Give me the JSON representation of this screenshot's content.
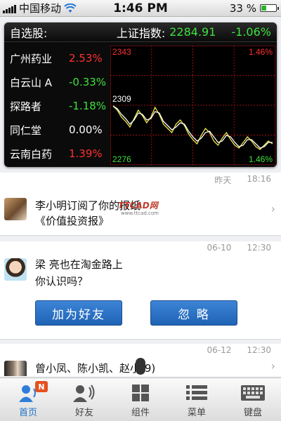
{
  "status_bar": {
    "carrier": "中国移动",
    "time": "1:46 PM",
    "battery": "33 %",
    "battery_level": 0.33
  },
  "stock_panel": {
    "title": "自选股:",
    "index_name": "上证指数:",
    "index_value": "2284.91",
    "index_change": "-1.06%",
    "stocks": [
      {
        "name": "广州药业",
        "pct": "2.53%",
        "color": "#ff3030"
      },
      {
        "name": "白云山 A",
        "pct": "-0.33%",
        "color": "#3fe03f"
      },
      {
        "name": "探路者",
        "pct": "-1.18%",
        "color": "#3fe03f"
      },
      {
        "name": "同仁堂",
        "pct": "0.00%",
        "color": "#ffffff"
      },
      {
        "name": "云南白药",
        "pct": "1.39%",
        "color": "#ff3030"
      }
    ],
    "chart": {
      "high_label": "2343",
      "mid_label": "2309",
      "low_label": "2276",
      "high_pct": "1.46%",
      "low_pct": "1.46%"
    }
  },
  "chart_data": {
    "type": "line",
    "ylim": [
      2276,
      2343
    ],
    "series": [
      {
        "values": [
          2309,
          2306,
          2301,
          2298,
          2294,
          2300,
          2306,
          2302,
          2297,
          2301,
          2308,
          2303,
          2296,
          2293,
          2290,
          2296,
          2299,
          2295,
          2289,
          2285,
          2282,
          2288,
          2293,
          2290,
          2284,
          2281,
          2286,
          2290,
          2285,
          2281,
          2279,
          2283,
          2287,
          2284,
          2280,
          2278,
          2281,
          2284,
          2282
        ]
      },
      {
        "values": [
          2309,
          2307,
          2303,
          2300,
          2296,
          2299,
          2304,
          2303,
          2299,
          2300,
          2305,
          2304,
          2298,
          2295,
          2292,
          2294,
          2297,
          2296,
          2291,
          2287,
          2284,
          2286,
          2290,
          2291,
          2287,
          2283,
          2284,
          2288,
          2287,
          2283,
          2280,
          2281,
          2285,
          2285,
          2282,
          2279,
          2280,
          2283,
          2283
        ]
      }
    ],
    "colors": [
      "#f2e84a",
      "#ffffff"
    ]
  },
  "feed": {
    "item1": {
      "date": "昨天",
      "time": "18:16",
      "line1": "李小明订阅了你的报纸",
      "line2": "《价值投资报》",
      "watermark": "TTCAD网",
      "watermark_sub": "www.ttcad.com"
    },
    "item2": {
      "date": "06-10",
      "time": "12:30",
      "line1": "梁 亮也在淘金路上",
      "line2": "你认识吗？",
      "add_friend": "加为好友",
      "ignore": "忽 略"
    },
    "item3": {
      "date": "06-12",
      "time": "12:30",
      "line1": "曾小凤、陈小凯、赵小(9)"
    }
  },
  "tabbar": {
    "badge": "N",
    "tabs": [
      {
        "label": "首页",
        "icon": "home-person-icon"
      },
      {
        "label": "好友",
        "icon": "friends-icon"
      },
      {
        "label": "组件",
        "icon": "grid-icon"
      },
      {
        "label": "菜单",
        "icon": "menu-list-icon"
      },
      {
        "label": "键盘",
        "icon": "keyboard-icon"
      }
    ]
  }
}
